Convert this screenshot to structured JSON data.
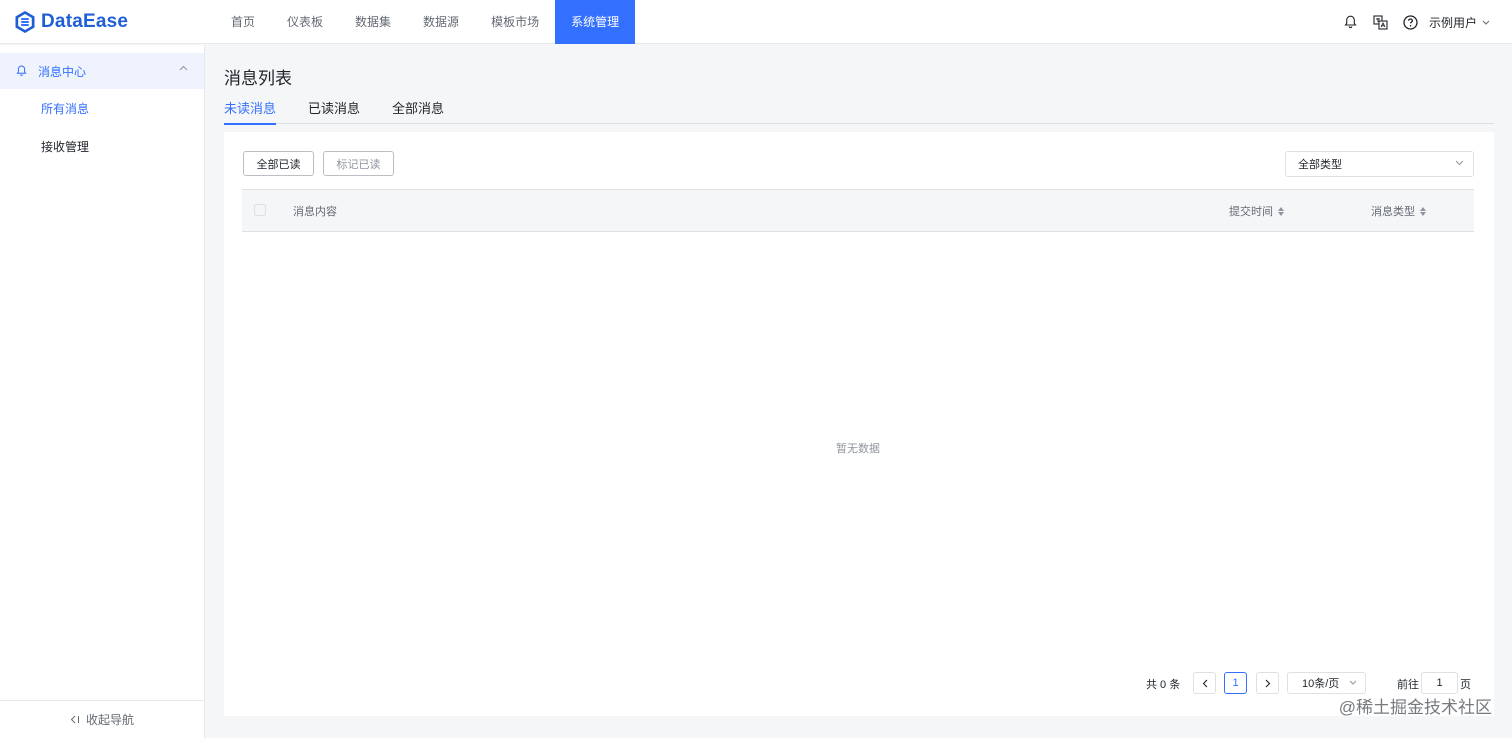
{
  "app": {
    "name": "DataEase"
  },
  "nav": {
    "items": [
      {
        "label": "首页"
      },
      {
        "label": "仪表板"
      },
      {
        "label": "数据集"
      },
      {
        "label": "数据源"
      },
      {
        "label": "模板市场"
      },
      {
        "label": "系统管理",
        "active": true
      }
    ]
  },
  "header": {
    "icons": [
      "bell-icon",
      "translate-icon",
      "help-circle-icon"
    ],
    "user": "示例用户"
  },
  "sidebar": {
    "group": "消息中心",
    "items": [
      {
        "label": "所有消息",
        "active": true
      },
      {
        "label": "接收管理"
      }
    ],
    "collapse_label": "收起导航"
  },
  "main": {
    "title": "消息列表",
    "tabs": [
      {
        "label": "未读消息",
        "active": true
      },
      {
        "label": "已读消息"
      },
      {
        "label": "全部消息"
      }
    ],
    "buttons": {
      "mark_all": "全部已读",
      "mark_selected": "标记已读"
    },
    "type_filter": "全部类型",
    "table": {
      "columns": [
        "消息内容",
        "提交时间",
        "消息类型"
      ],
      "empty_text": "暂无数据"
    },
    "pagination": {
      "total_label": "共 0 条",
      "current_page": "1",
      "page_size": "10条/页",
      "goto_label": "前往",
      "goto_value": "1",
      "page_suffix": "页"
    }
  },
  "watermark": "@稀土掘金技术社区",
  "colors": {
    "accent": "#3370ff",
    "logo": "#1f5fd6"
  }
}
